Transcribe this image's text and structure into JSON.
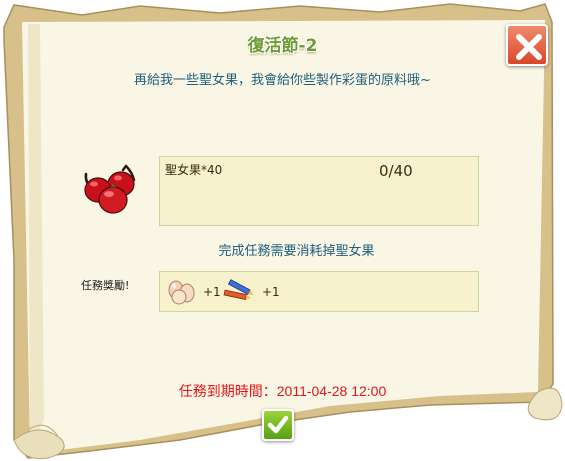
{
  "dialog": {
    "title": "復活節-2",
    "subtitle": "再給我一些聖女果，我會給你些製作彩蛋的原料哦~"
  },
  "requirement": {
    "item_icon": "cherry-tomato-icon",
    "label": "聖女果*40",
    "progress": "0/40"
  },
  "consume_note": "完成任務需要消耗掉聖女果",
  "reward": {
    "label": "任務獎勵!",
    "items": [
      {
        "icon": "eggs-icon",
        "quantity": "+1"
      },
      {
        "icon": "paint-crayons-icon",
        "quantity": "+1"
      }
    ]
  },
  "deadline": {
    "label": "任務到期時間：",
    "value": "2011-04-28 12:00"
  },
  "buttons": {
    "close_icon": "close-icon",
    "confirm_icon": "checkmark-icon"
  },
  "colors": {
    "title": "#6f9b35",
    "text_blue": "#1f5e7c",
    "deadline_red": "#e0161b",
    "panel_fill": "#f7f2cc",
    "parchment": "#f9f6e6",
    "close_red": "#d9462a",
    "confirm_green": "#57a015"
  }
}
